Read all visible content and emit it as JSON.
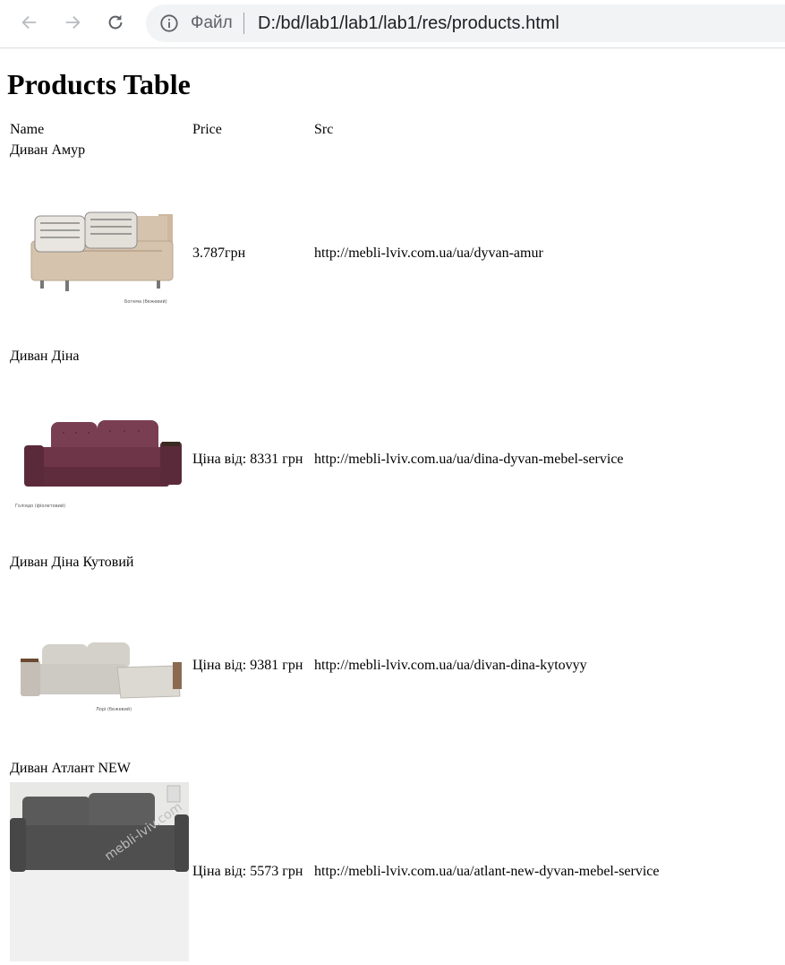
{
  "browser": {
    "back_icon": "arrow-left-icon",
    "forward_icon": "arrow-right-icon",
    "reload_icon": "reload-icon",
    "info_icon": "info-icon",
    "scheme_label": "Файл",
    "url": "D:/bd/lab1/lab1/lab1/res/products.html"
  },
  "page": {
    "title": "Products Table"
  },
  "table": {
    "headers": {
      "name": "Name",
      "price": "Price",
      "src": "Src"
    },
    "products": [
      {
        "name": "Диван Амур",
        "price": "3.787грн",
        "src": "http://mebli-lviv.com.ua/ua/dyvan-amur",
        "image_caption": "Богема (бежевий)",
        "color": "#d6c3ad"
      },
      {
        "name": "Диван Діна",
        "price": "Ціна від: 8331 грн",
        "src": "http://mebli-lviv.com.ua/ua/dina-dyvan-mebel-service",
        "image_caption": "Голіядо (фіолетовий)",
        "color": "#6e3548"
      },
      {
        "name": "Диван Діна Кутовий",
        "price": "Ціна від: 9381 грн",
        "src": "http://mebli-lviv.com.ua/ua/divan-dina-kytovyy",
        "image_caption": "Лорі (бежевий)",
        "color": "#cdc9c3"
      },
      {
        "name": "Диван Атлант NEW",
        "price": "Ціна від: 5573 грн",
        "src": "http://mebli-lviv.com.ua/ua/atlant-new-dyvan-mebel-service",
        "image_caption": "",
        "color": "#555555"
      }
    ]
  }
}
